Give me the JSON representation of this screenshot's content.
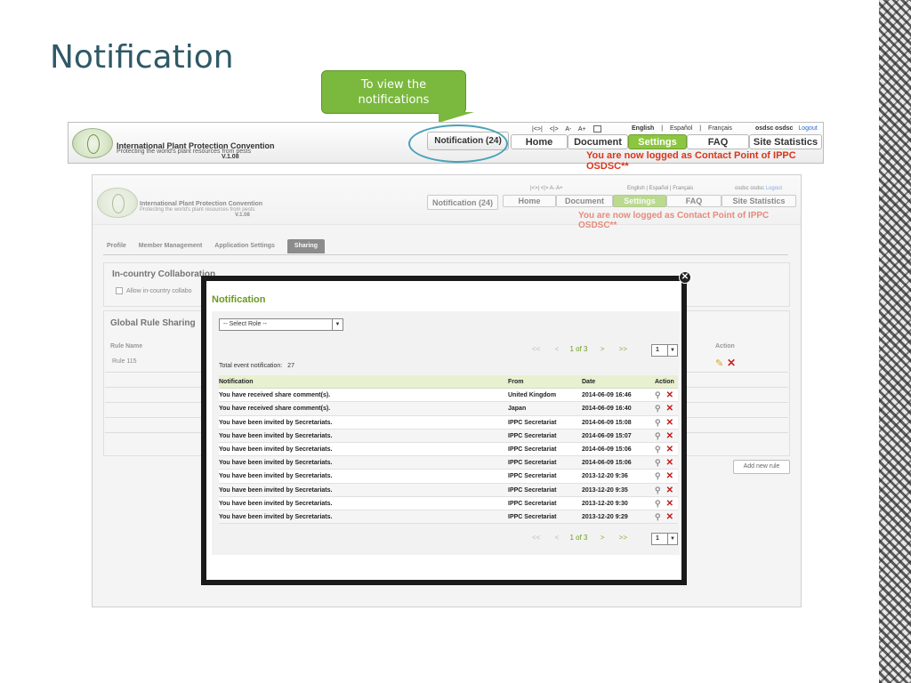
{
  "slide": {
    "title": "Notification"
  },
  "callout": {
    "line1": "To view the",
    "line2": "notifications"
  },
  "header": {
    "org_name": "International Plant Protection Convention",
    "org_sub": "Protecting the world's plant resources from pests",
    "version": "V.1.08",
    "tools": [
      "|<>|",
      "<|>",
      "A-",
      "A+"
    ],
    "languages": [
      "English",
      "|",
      "Español",
      "|",
      "Français"
    ],
    "user": "osdsc osdsc",
    "logout": "Logout",
    "notification_btn": "Notification (24)",
    "nav": [
      "Home",
      "Document",
      "Settings",
      "FAQ",
      "Site Statistics"
    ],
    "active_nav": "Settings",
    "logged_msg": "You are now logged as Contact Point of IPPC OSDSC**"
  },
  "shot": {
    "tabs": [
      "Profile",
      "Member Management",
      "Application Settings",
      "Sharing"
    ],
    "active_tab": "Sharing",
    "incountry_title": "In-country Collaboration",
    "incountry_option": "Allow in-country collabo",
    "global_title": "Global Rule Sharing",
    "rule_name_header": "Rule Name",
    "rule_row": "Rule 115",
    "action_header": "Action",
    "add_rule": "Add new rule"
  },
  "modal": {
    "title": "Notification",
    "select_role": "-- Select Role --",
    "pager": {
      "first": "<<",
      "prev": "<",
      "page_of": "1 of 3",
      "next": ">",
      "last": ">>",
      "page": "1"
    },
    "total_label": "Total event notification:",
    "total_value": "27",
    "columns": {
      "notification": "Notification",
      "from": "From",
      "date": "Date",
      "action": "Action"
    },
    "rows": [
      {
        "notification": "You have received share comment(s).",
        "from": "United Kingdom",
        "date": "2014-06-09 16:46"
      },
      {
        "notification": "You have received share comment(s).",
        "from": "Japan",
        "date": "2014-06-09 16:40"
      },
      {
        "notification": "You have been invited by Secretariats.",
        "from": "IPPC Secretariat",
        "date": "2014-06-09 15:08"
      },
      {
        "notification": "You have been invited by Secretariats.",
        "from": "IPPC Secretariat",
        "date": "2014-06-09 15:07"
      },
      {
        "notification": "You have been invited by Secretariats.",
        "from": "IPPC Secretariat",
        "date": "2014-06-09 15:06"
      },
      {
        "notification": "You have been invited by Secretariats.",
        "from": "IPPC Secretariat",
        "date": "2014-06-09 15:06"
      },
      {
        "notification": "You have been invited by Secretariats.",
        "from": "IPPC Secretariat",
        "date": "2013-12-20 9:36"
      },
      {
        "notification": "You have been invited by Secretariats.",
        "from": "IPPC Secretariat",
        "date": "2013-12-20 9:35"
      },
      {
        "notification": "You have been invited by Secretariats.",
        "from": "IPPC Secretariat",
        "date": "2013-12-20 9:30"
      },
      {
        "notification": "You have been invited by Secretariats.",
        "from": "IPPC Secretariat",
        "date": "2013-12-20 9:29"
      }
    ]
  },
  "colors": {
    "accent_green": "#8cc63e",
    "title_teal": "#2f5966",
    "alert_red": "#d9351a",
    "link_blue": "#2a6ed8"
  },
  "icons": {
    "view": "magnifier-icon",
    "delete": "delete-x-icon",
    "close": "close-icon"
  }
}
